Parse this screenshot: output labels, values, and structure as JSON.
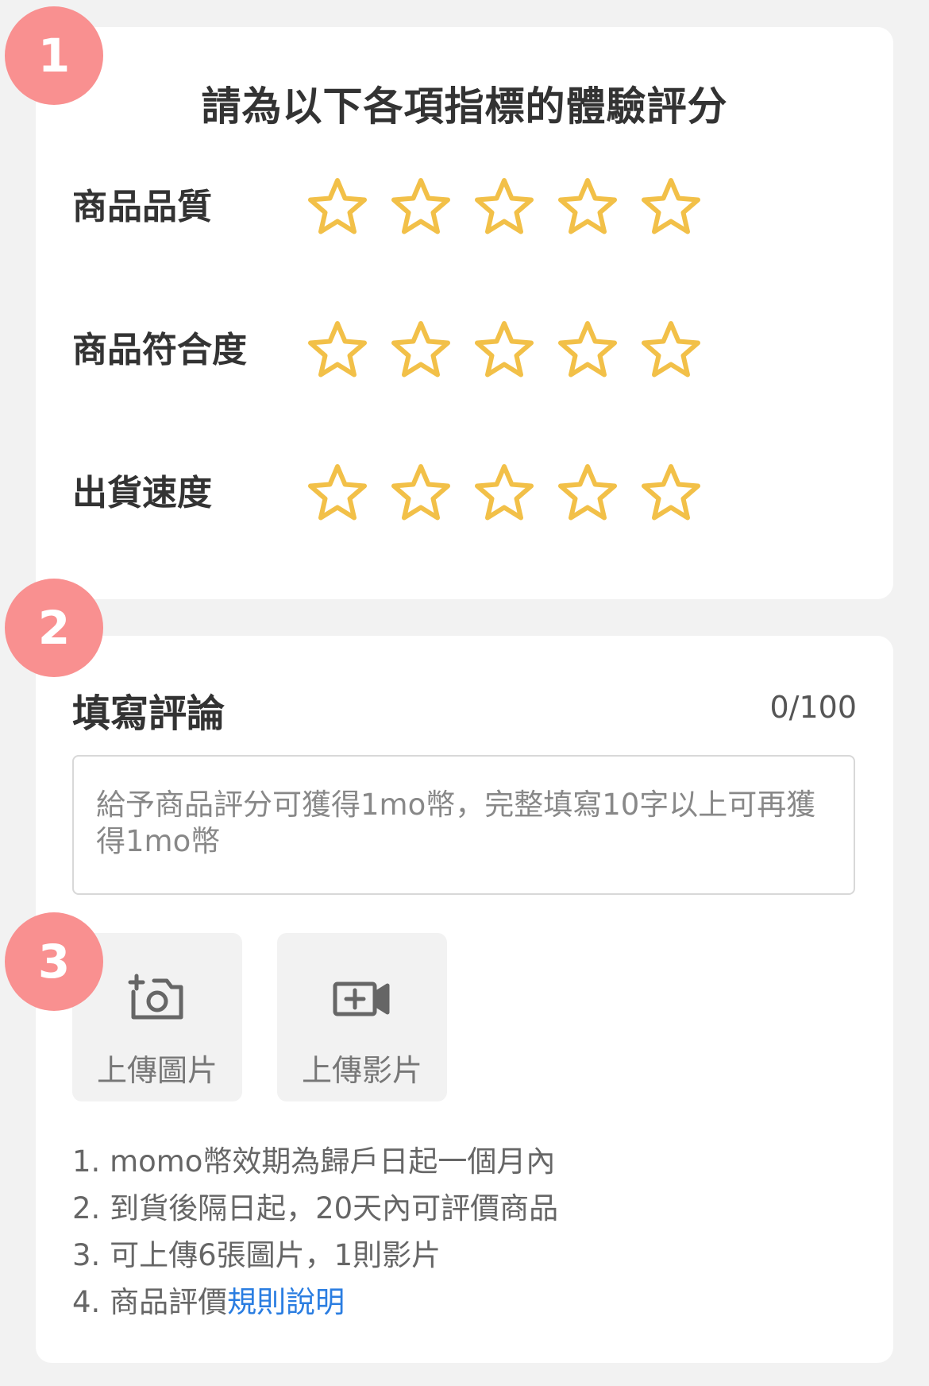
{
  "rating": {
    "badge": "1",
    "title": "請為以下各項指標的體驗評分",
    "rows": [
      {
        "label": "商品品質",
        "stars": 0
      },
      {
        "label": "商品符合度",
        "stars": 0
      },
      {
        "label": "出貨速度",
        "stars": 0
      }
    ],
    "star_color": "#f2c048"
  },
  "review": {
    "badge": "2",
    "title": "填寫評論",
    "count": "0/100",
    "placeholder": "給予商品評分可獲得1mo幣，完整填寫10字以上可再獲得1mo幣"
  },
  "upload": {
    "badge": "3",
    "photo_label": "上傳圖片",
    "video_label": "上傳影片",
    "photo_icon": "camera-plus-icon",
    "video_icon": "video-plus-icon"
  },
  "notes": {
    "items": [
      "1. momo幣效期為歸戶日起一個月內",
      "2. 到貨後隔日起，20天內可評價商品",
      "3. 可上傳6張圖片，1則影片"
    ],
    "item4_prefix": "4. 商品評價",
    "item4_link": "規則說明"
  },
  "colors": {
    "badge": "#f99090",
    "link": "#2a7de1",
    "background": "#f2f2f2"
  }
}
